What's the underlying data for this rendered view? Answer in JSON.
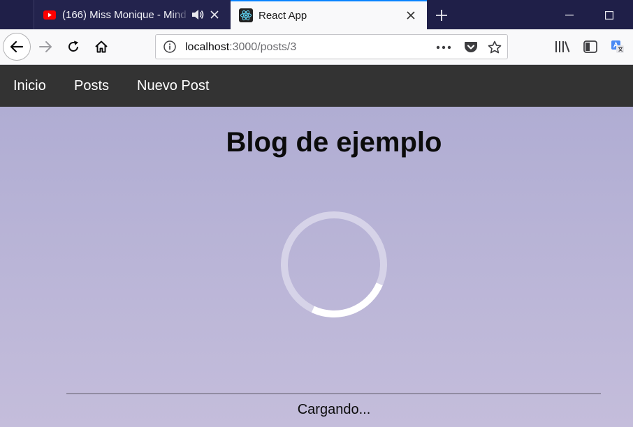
{
  "browser": {
    "tabs": [
      {
        "title": "(166) Miss Monique - Mind",
        "favicon": "youtube-icon",
        "state": "inactive",
        "audio": "speaker-icon"
      },
      {
        "title": "React App",
        "favicon": "react-icon",
        "state": "active"
      }
    ],
    "url": {
      "host": "localhost",
      "rest": ":3000/posts/3"
    },
    "toolbar_icons": [
      "back-icon",
      "forward-icon",
      "reload-icon",
      "home-icon",
      "page-actions-icon",
      "pocket-icon",
      "bookmark-star-icon",
      "library-icon",
      "sidebar-icon",
      "translate-icon"
    ],
    "colors": {
      "tabstrip": "#1f1f48",
      "active_tab_accent": "#0a84ff"
    }
  },
  "app": {
    "nav": [
      {
        "label": "Inicio"
      },
      {
        "label": "Posts"
      },
      {
        "label": "Nuevo Post"
      }
    ],
    "heading": "Blog de ejemplo",
    "loading_text": "Cargando...",
    "colors": {
      "navbar": "#333333",
      "background": "#b5b0d3"
    }
  }
}
